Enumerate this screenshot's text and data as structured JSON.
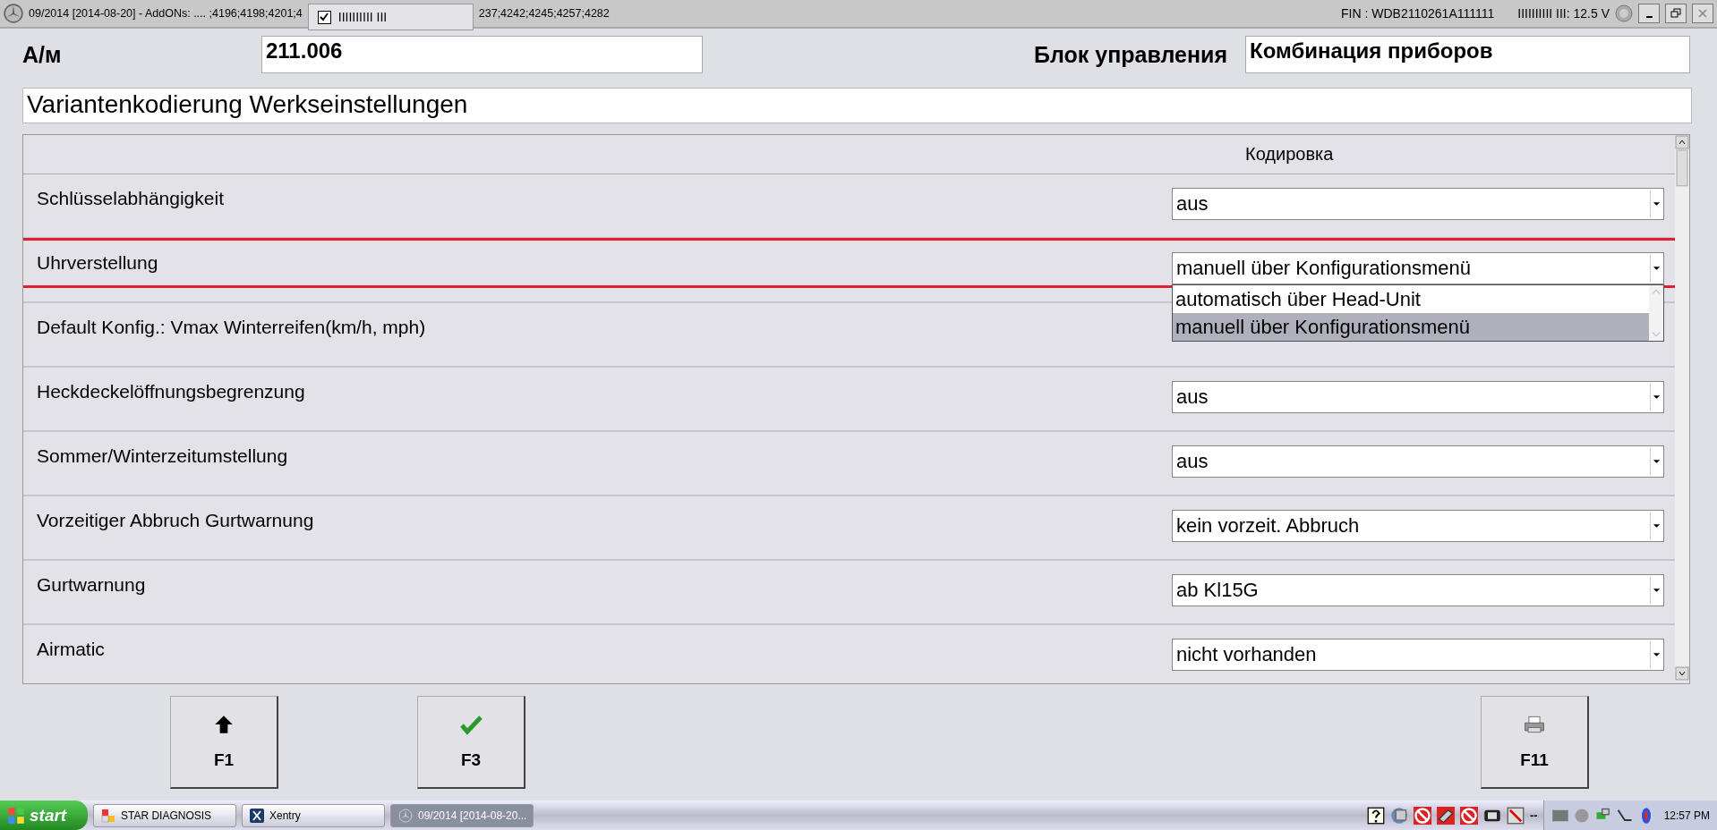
{
  "title_bar": {
    "title_left": "09/2014 [2014-08-20] - AddONs:  .... ;4196;4198;4201;4",
    "title_right": "237;4242;4245;4257;4282",
    "overlay": {
      "checked": true,
      "text": "IIIIIIIIII III"
    },
    "fin": "FIN : WDB2110261A111111",
    "voltage": "IIIIIIIIII III: 12.5 V"
  },
  "header": {
    "vehicle_label": "А/м",
    "vehicle_value": "211.006",
    "unit_label": "Блок управления",
    "unit_value": "Комбинация приборов"
  },
  "section_title": "Variantenkodierung Werkseinstellungen",
  "table": {
    "column_heading": "Кодировка",
    "rows": [
      {
        "name": "Schlüsselabhängigkeit",
        "value": "aus",
        "highlighted": false
      },
      {
        "name": "Uhrverstellung",
        "value": "manuell über Konfigurationsmenü",
        "highlighted": true,
        "expanded": true,
        "options": [
          {
            "label": "automatisch über Head-Unit",
            "selected": false
          },
          {
            "label": "manuell über Konfigurationsmenü",
            "selected": true
          }
        ]
      },
      {
        "name": "Default Konfig.: Vmax Winterreifen(km/h, mph)",
        "highlighted": false
      },
      {
        "name": "Heckdeckelöffnungsbegrenzung",
        "value": "aus",
        "highlighted": false
      },
      {
        "name": "Sommer/Winterzeitumstellung",
        "value": "aus",
        "highlighted": false
      },
      {
        "name": "Vorzeitiger Abbruch Gurtwarnung",
        "value": "kein vorzeit. Abbruch",
        "highlighted": false
      },
      {
        "name": "Gurtwarnung",
        "value": "ab Kl15G",
        "highlighted": false
      },
      {
        "name": "Airmatic",
        "value": "nicht vorhanden",
        "highlighted": false
      }
    ]
  },
  "function_keys": [
    {
      "kind": "up",
      "label": "F1"
    },
    {
      "kind": "check",
      "label": "F3"
    },
    {
      "kind": "print",
      "label": "F11"
    }
  ],
  "taskbar": {
    "start": "start",
    "tasks": [
      {
        "kind": "star",
        "label": "STAR DIAGNOSIS",
        "selected": false
      },
      {
        "kind": "xentry",
        "label": "Xentry",
        "selected": false
      },
      {
        "kind": "star-logo",
        "label": "09/2014 [2014-08-20...",
        "selected": true
      }
    ],
    "tray_text": "--",
    "clock": "12:57 PM"
  }
}
